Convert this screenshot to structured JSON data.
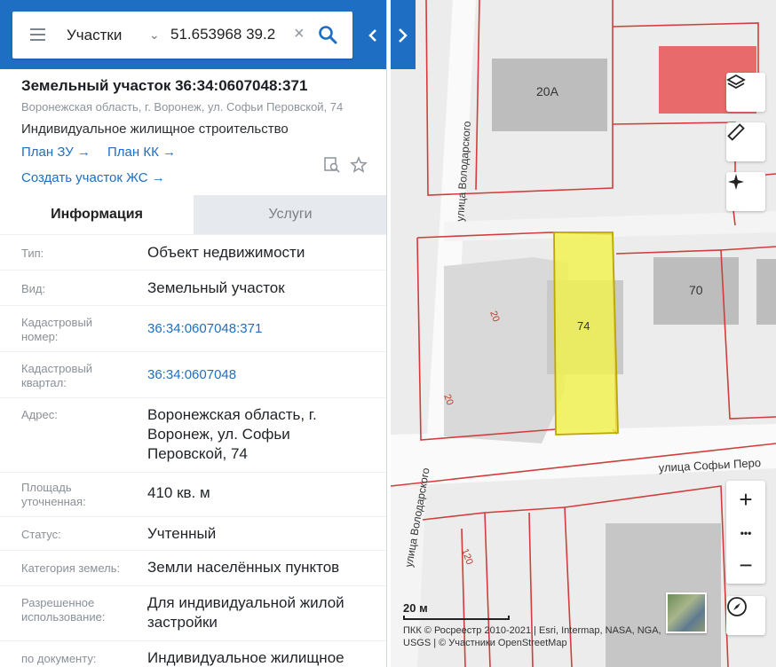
{
  "search": {
    "category": "Участки",
    "value": "51.653968 39.2",
    "placeholder": ""
  },
  "parcel": {
    "title": "Земельный участок 36:34:0607048:371",
    "address_short": "Воронежская область, г. Воронеж, ул. Софьи Перовской, 74",
    "usage": "Индивидуальное жилищное строительство",
    "links": {
      "plan_zu": "План ЗУ →",
      "plan_kk": "План КК →",
      "create_zhs": "Создать участок ЖС →"
    }
  },
  "tabs": {
    "info": "Информация",
    "services": "Услуги"
  },
  "info_rows": [
    {
      "label": "Тип:",
      "value": "Объект недвижимости"
    },
    {
      "label": "Вид:",
      "value": "Земельный участок"
    },
    {
      "label": "Кадастровый номер:",
      "value": "36:34:0607048:371"
    },
    {
      "label": "Кадастровый квартал:",
      "value": "36:34:0607048"
    },
    {
      "label": "Адрес:",
      "value": "Воронежская область, г. Воронеж, ул. Софьи Перовской, 74"
    },
    {
      "label": "Площадь уточненная:",
      "value": "410 кв. м"
    },
    {
      "label": "Статус:",
      "value": "Учтенный"
    },
    {
      "label": "Категория земель:",
      "value": "Земли населённых пунктов"
    },
    {
      "label": "Разрешенное использование:",
      "value": "Для индивидуальной жилой застройки"
    },
    {
      "label": "по документу:",
      "value": "Индивидуальное жилищное"
    }
  ],
  "map": {
    "labels": {
      "bldg_20a": "20А",
      "bldg_70": "70",
      "parcel_74": "74",
      "street_volodarsky": "улица Володарского",
      "street_volodarsky_2": "улица Володарского",
      "street_sofia": "улица Софьи Перо",
      "lot_20": "20",
      "lot_20b": "20",
      "lot_120": "120"
    },
    "scale_label": "20 м",
    "attribution": "ПКК © Росреестр 2010-2021 | Esri, Intermap, NASA, NGA, USGS | © Участники OpenStreetMap",
    "zoom_in": "+",
    "zoom_more": "•••",
    "zoom_out": "−",
    "highlight_color": "#f3f24d",
    "boundary_color": "#d43c3c"
  }
}
